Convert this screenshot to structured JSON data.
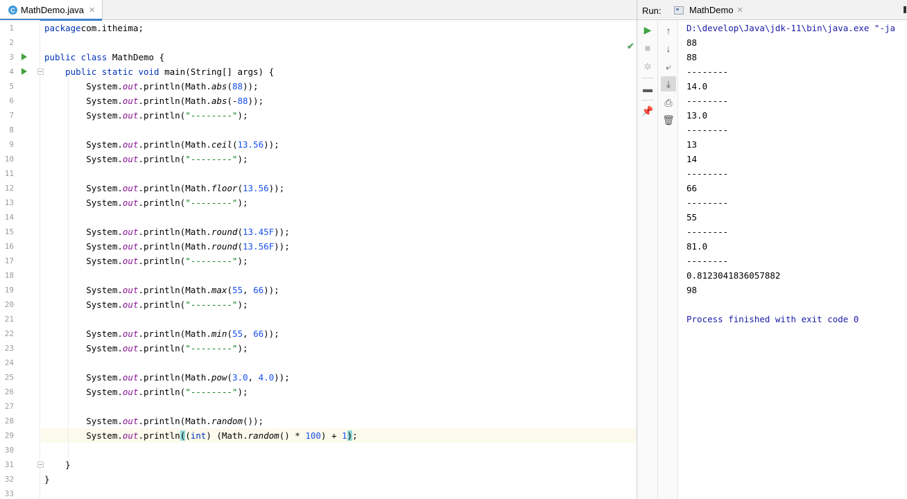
{
  "editor": {
    "tab": {
      "label": "MathDemo.java",
      "icon": "class-icon",
      "icon_letter": "C"
    },
    "line_numbers": [
      "1",
      "2",
      "3",
      "4",
      "5",
      "6",
      "7",
      "8",
      "9",
      "10",
      "11",
      "12",
      "13",
      "14",
      "15",
      "16",
      "17",
      "18",
      "19",
      "20",
      "21",
      "22",
      "23",
      "24",
      "25",
      "26",
      "27",
      "28",
      "29",
      "30",
      "31",
      "32",
      "33"
    ],
    "lines": [
      [
        [
          "kw",
          "package"
        ],
        [
          "",
          "com.itheima;"
        ]
      ],
      [],
      [
        [
          "kw",
          "public class "
        ],
        [
          "",
          "MathDemo {"
        ]
      ],
      [
        [
          "kw",
          "    public static void "
        ],
        [
          "",
          "main(String[] args) {"
        ]
      ],
      [
        [
          "",
          "        System."
        ],
        [
          "field",
          "out"
        ],
        [
          "",
          ".println(Math."
        ],
        [
          "italic",
          "abs"
        ],
        [
          "",
          "("
        ],
        [
          "num",
          "88"
        ],
        [
          "",
          "));"
        ]
      ],
      [
        [
          "",
          "        System."
        ],
        [
          "field",
          "out"
        ],
        [
          "",
          ".println(Math."
        ],
        [
          "italic",
          "abs"
        ],
        [
          "",
          "(-"
        ],
        [
          "num",
          "88"
        ],
        [
          "",
          "));"
        ]
      ],
      [
        [
          "",
          "        System."
        ],
        [
          "field",
          "out"
        ],
        [
          "",
          ".println("
        ],
        [
          "str",
          "\"--------\""
        ],
        [
          "",
          ");"
        ]
      ],
      [],
      [
        [
          "",
          "        System."
        ],
        [
          "field",
          "out"
        ],
        [
          "",
          ".println(Math."
        ],
        [
          "italic",
          "ceil"
        ],
        [
          "",
          "("
        ],
        [
          "num",
          "13.56"
        ],
        [
          "",
          "));"
        ]
      ],
      [
        [
          "",
          "        System."
        ],
        [
          "field",
          "out"
        ],
        [
          "",
          ".println("
        ],
        [
          "str",
          "\"--------\""
        ],
        [
          "",
          ");"
        ]
      ],
      [],
      [
        [
          "",
          "        System."
        ],
        [
          "field",
          "out"
        ],
        [
          "",
          ".println(Math."
        ],
        [
          "italic",
          "floor"
        ],
        [
          "",
          "("
        ],
        [
          "num",
          "13.56"
        ],
        [
          "",
          "));"
        ]
      ],
      [
        [
          "",
          "        System."
        ],
        [
          "field",
          "out"
        ],
        [
          "",
          ".println("
        ],
        [
          "str",
          "\"--------\""
        ],
        [
          "",
          ");"
        ]
      ],
      [],
      [
        [
          "",
          "        System."
        ],
        [
          "field",
          "out"
        ],
        [
          "",
          ".println(Math."
        ],
        [
          "italic",
          "round"
        ],
        [
          "",
          "("
        ],
        [
          "num",
          "13.45F"
        ],
        [
          "",
          "));"
        ]
      ],
      [
        [
          "",
          "        System."
        ],
        [
          "field",
          "out"
        ],
        [
          "",
          ".println(Math."
        ],
        [
          "italic",
          "round"
        ],
        [
          "",
          "("
        ],
        [
          "num",
          "13.56F"
        ],
        [
          "",
          "));"
        ]
      ],
      [
        [
          "",
          "        System."
        ],
        [
          "field",
          "out"
        ],
        [
          "",
          ".println("
        ],
        [
          "str",
          "\"--------\""
        ],
        [
          "",
          ");"
        ]
      ],
      [],
      [
        [
          "",
          "        System."
        ],
        [
          "field",
          "out"
        ],
        [
          "",
          ".println(Math."
        ],
        [
          "italic",
          "max"
        ],
        [
          "",
          "("
        ],
        [
          "num",
          "55"
        ],
        [
          "",
          ", "
        ],
        [
          "num",
          "66"
        ],
        [
          "",
          "));"
        ]
      ],
      [
        [
          "",
          "        System."
        ],
        [
          "field",
          "out"
        ],
        [
          "",
          ".println("
        ],
        [
          "str",
          "\"--------\""
        ],
        [
          "",
          ");"
        ]
      ],
      [],
      [
        [
          "",
          "        System."
        ],
        [
          "field",
          "out"
        ],
        [
          "",
          ".println(Math."
        ],
        [
          "italic",
          "min"
        ],
        [
          "",
          "("
        ],
        [
          "num",
          "55"
        ],
        [
          "",
          ", "
        ],
        [
          "num",
          "66"
        ],
        [
          "",
          "));"
        ]
      ],
      [
        [
          "",
          "        System."
        ],
        [
          "field",
          "out"
        ],
        [
          "",
          ".println("
        ],
        [
          "str",
          "\"--------\""
        ],
        [
          "",
          ");"
        ]
      ],
      [],
      [
        [
          "",
          "        System."
        ],
        [
          "field",
          "out"
        ],
        [
          "",
          ".println(Math."
        ],
        [
          "italic",
          "pow"
        ],
        [
          "",
          "("
        ],
        [
          "num",
          "3.0"
        ],
        [
          "",
          ", "
        ],
        [
          "num",
          "4.0"
        ],
        [
          "",
          "));"
        ]
      ],
      [
        [
          "",
          "        System."
        ],
        [
          "field",
          "out"
        ],
        [
          "",
          ".println("
        ],
        [
          "str",
          "\"--------\""
        ],
        [
          "",
          ");"
        ]
      ],
      [],
      [
        [
          "",
          "        System."
        ],
        [
          "field",
          "out"
        ],
        [
          "",
          ".println(Math."
        ],
        [
          "italic",
          "random"
        ],
        [
          "",
          "());"
        ]
      ],
      [
        [
          "",
          "        System."
        ],
        [
          "field",
          "out"
        ],
        [
          "",
          ".println"
        ],
        [
          "brace-hl",
          "("
        ],
        [
          "",
          "("
        ],
        [
          "kw",
          "int"
        ],
        [
          "",
          ") (Math."
        ],
        [
          "italic",
          "random"
        ],
        [
          "",
          "() * "
        ],
        [
          "num",
          "100"
        ],
        [
          "",
          ") + "
        ],
        [
          "num",
          "1"
        ],
        [
          "brace-hl",
          ")"
        ],
        [
          "",
          ";"
        ]
      ],
      [],
      [
        [
          "",
          "    }"
        ]
      ],
      [
        [
          "",
          "}"
        ]
      ],
      []
    ],
    "run_gutter_lines": [
      3,
      4
    ],
    "fold_lines": [
      4,
      31
    ],
    "current_line": 29,
    "status_icon": "check-icon"
  },
  "run_panel": {
    "label": "Run:",
    "tab_label": "MathDemo",
    "toolbar_left": [
      {
        "name": "rerun-icon",
        "glyph": "▶",
        "color": "#3fa33f"
      },
      {
        "name": "stop-icon",
        "glyph": "■",
        "color": "#c2c2c2"
      },
      {
        "name": "debug-settings-icon",
        "glyph": "✲",
        "color": "#c2c2c2"
      },
      {
        "name": "layout-icon",
        "glyph": "▬",
        "color": "#5a5a5a"
      },
      {
        "name": "pin-icon",
        "glyph": "📌",
        "color": "#5a5a5a"
      }
    ],
    "toolbar_right": [
      {
        "name": "scroll-up-icon",
        "glyph": "↑",
        "color": "#555"
      },
      {
        "name": "scroll-down-icon",
        "glyph": "↓",
        "color": "#555"
      },
      {
        "name": "soft-wrap-icon",
        "glyph": "⤶",
        "color": "#555"
      },
      {
        "name": "scroll-to-end-icon",
        "glyph": "⤓",
        "color": "#555",
        "active": true
      },
      {
        "name": "print-icon",
        "glyph": "⎙",
        "color": "#555"
      },
      {
        "name": "trash-icon",
        "glyph": "🗑",
        "color": "#555"
      }
    ],
    "output": [
      {
        "text": "D:\\develop\\Java\\jdk-11\\bin\\java.exe \"-ja",
        "type": "sys"
      },
      {
        "text": "88",
        "type": "out"
      },
      {
        "text": "88",
        "type": "out"
      },
      {
        "text": "--------",
        "type": "out"
      },
      {
        "text": "14.0",
        "type": "out"
      },
      {
        "text": "--------",
        "type": "out"
      },
      {
        "text": "13.0",
        "type": "out"
      },
      {
        "text": "--------",
        "type": "out"
      },
      {
        "text": "13",
        "type": "out"
      },
      {
        "text": "14",
        "type": "out"
      },
      {
        "text": "--------",
        "type": "out"
      },
      {
        "text": "66",
        "type": "out"
      },
      {
        "text": "--------",
        "type": "out"
      },
      {
        "text": "55",
        "type": "out"
      },
      {
        "text": "--------",
        "type": "out"
      },
      {
        "text": "81.0",
        "type": "out"
      },
      {
        "text": "--------",
        "type": "out"
      },
      {
        "text": "0.8123041836057882",
        "type": "out"
      },
      {
        "text": "98",
        "type": "out"
      },
      {
        "text": "",
        "type": "out"
      },
      {
        "text": "Process finished with exit code 0",
        "type": "sys"
      }
    ]
  }
}
